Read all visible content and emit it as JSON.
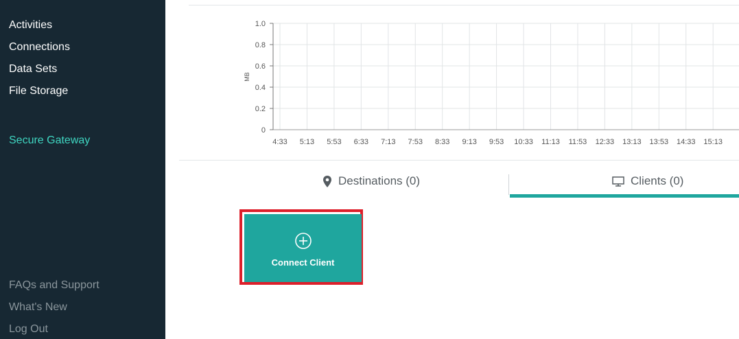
{
  "sidebar": {
    "items": [
      {
        "label": "Activities"
      },
      {
        "label": "Connections"
      },
      {
        "label": "Data Sets"
      },
      {
        "label": "File Storage"
      },
      {
        "label": "Secure Gateway",
        "active": true
      }
    ],
    "footer": [
      {
        "label": "FAQs and Support"
      },
      {
        "label": "What's New"
      },
      {
        "label": "Log Out"
      }
    ]
  },
  "chart_data": {
    "type": "line",
    "ylabel": "MB",
    "xlabel": "",
    "ylim": [
      0,
      1.0
    ],
    "yticks": [
      "1.0",
      "0.8",
      "0.6",
      "0.4",
      "0.2",
      "0"
    ],
    "x": [
      "4:33",
      "5:13",
      "5:53",
      "6:33",
      "7:13",
      "7:53",
      "8:33",
      "9:13",
      "9:53",
      "10:33",
      "11:13",
      "11:53",
      "12:33",
      "13:13",
      "13:53",
      "14:33",
      "15:13"
    ],
    "grid": true,
    "series": []
  },
  "tabs": [
    {
      "label": "Destinations (0)",
      "icon": "map-pin-icon",
      "active": false
    },
    {
      "label": "Clients (0)",
      "icon": "monitor-icon",
      "active": true
    }
  ],
  "connect_card": {
    "label": "Connect Client",
    "icon": "plus-circle-icon"
  },
  "colors": {
    "sidebar_bg": "#172833",
    "accent": "#1fa69e",
    "active_nav": "#3fd6c1",
    "highlight": "#dd1f2a"
  }
}
